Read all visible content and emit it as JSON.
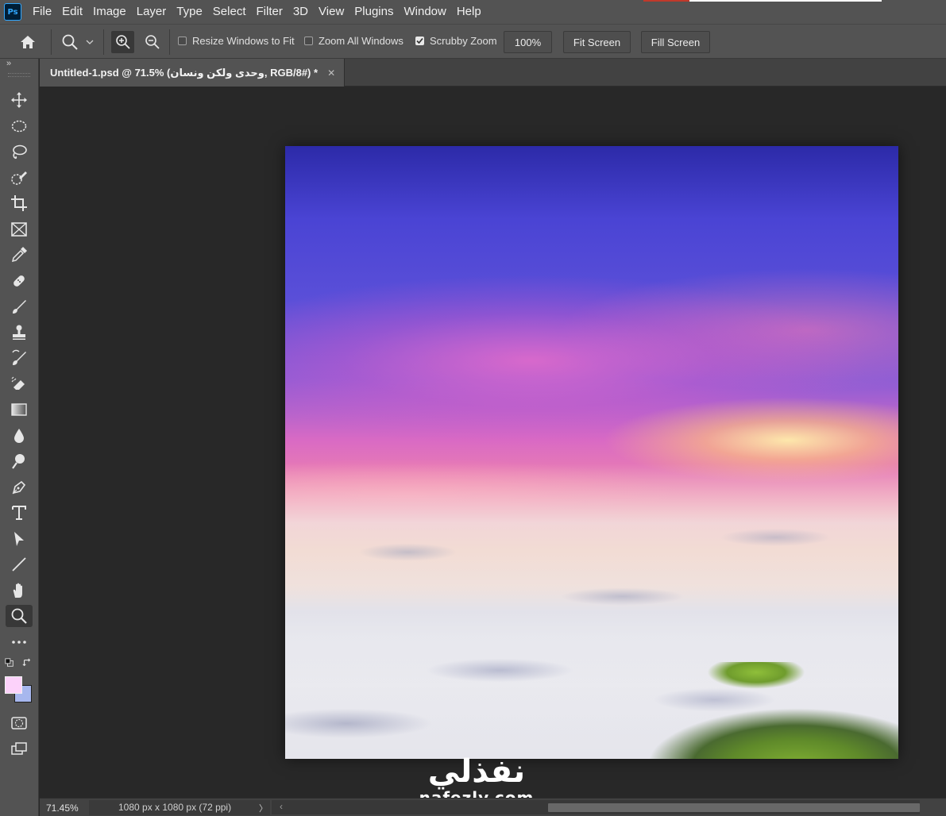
{
  "app": {
    "logo_text": "Ps"
  },
  "menu": [
    "File",
    "Edit",
    "Image",
    "Layer",
    "Type",
    "Select",
    "Filter",
    "3D",
    "View",
    "Plugins",
    "Window",
    "Help"
  ],
  "options": {
    "resize_windows_label": "Resize Windows to Fit",
    "resize_windows_checked": false,
    "zoom_all_label": "Zoom All Windows",
    "zoom_all_checked": false,
    "scrubby_zoom_label": "Scrubby Zoom",
    "scrubby_zoom_checked": true,
    "hundred_percent_label": "100%",
    "fit_screen_label": "Fit Screen",
    "fill_screen_label": "Fill Screen"
  },
  "document": {
    "tab_title": "Untitled-1.psd @ 71.5% (وحدى ولكن ونسان, RGB/8#) *",
    "close_glyph": "✕"
  },
  "toolbar": {
    "collapse_glyph": "»",
    "tools": [
      "move-tool",
      "marquee-tool",
      "lasso-tool",
      "quick-selection-tool",
      "crop-tool",
      "frame-tool",
      "eyedropper-tool",
      "healing-brush-tool",
      "brush-tool",
      "clone-stamp-tool",
      "history-brush-tool",
      "eraser-tool",
      "gradient-tool",
      "blur-tool",
      "dodge-tool",
      "pen-tool",
      "type-tool",
      "path-selection-tool",
      "line-tool",
      "hand-tool",
      "zoom-tool",
      "more-tools"
    ],
    "active_tool": "zoom-tool",
    "foreground_color": "#fcd2fa",
    "background_color": "#a7b7ee"
  },
  "watermark": {
    "arabic": "نفذلي",
    "latin": "nafezly.com"
  },
  "status": {
    "zoom": "71.45%",
    "doc_info": "1080 px x 1080 px (72 ppi)",
    "arrow": "〉",
    "scroll_left": "‹"
  }
}
